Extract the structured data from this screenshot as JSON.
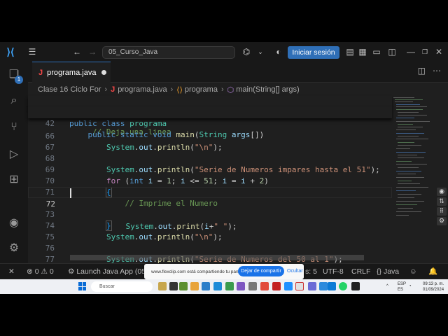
{
  "titlebar": {
    "search_text": "05_Curso_Java",
    "signin_label": "Iniciar sesión"
  },
  "activity": {
    "explorer_badge": "1"
  },
  "tab": {
    "filename": "programa.java"
  },
  "breadcrumb": {
    "folder": "Clase 16 Ciclo For",
    "file": "programa.java",
    "class": "programa",
    "method": "main(String[] args)"
  },
  "editor": {
    "lines": [
      {
        "n": "41",
        "code": "public class programa"
      },
      {
        "n": "42",
        "code": "    public static void main(String args[])"
      },
      {
        "n": "66",
        "code": "        System.out.println(\"\\n\");"
      },
      {
        "n": "67",
        "code": ""
      },
      {
        "n": "68",
        "code": "        System.out.println(\"Serie de Numeros impares hasta el 51\");"
      },
      {
        "n": "69",
        "code": "        for (int i = 1; i <= 51; i = i + 2)"
      },
      {
        "n": "70",
        "code": "        {"
      },
      {
        "n": "71",
        "code": "            // Imprime el Numero"
      },
      {
        "n": "72",
        "code": "            System.out.print(i+\" \");"
      },
      {
        "n": "73",
        "code": "        }"
      },
      {
        "n": "74",
        "code": "        System.out.println(\"\\n\");"
      },
      {
        "n": "75",
        "code": ""
      },
      {
        "n": "76",
        "code": "        System.out.println(\"Serie de Numeros del 50 al 1\");"
      },
      {
        "n": "77",
        "code": "        for (int i = 50; i > 0; i--)"
      }
    ],
    "partial_comment": "// Deja una linea"
  },
  "statusbar": {
    "errors": "0",
    "warnings": "0",
    "launch": "Launch Java App (05",
    "spaces": "s: 5",
    "encoding": "UTF-8",
    "eol": "CRLF",
    "language": "Java"
  },
  "share_banner": {
    "message": "www.flexclip.com está compartiendo tu pantalla.",
    "stop_label": "Dejar de compartir",
    "hide_label": "Ocultar"
  },
  "taskbar": {
    "search_placeholder": "Buscar",
    "lang": "ESP",
    "lang2": "ES",
    "time": "09:13 p. m.",
    "date": "01/09/2024"
  }
}
